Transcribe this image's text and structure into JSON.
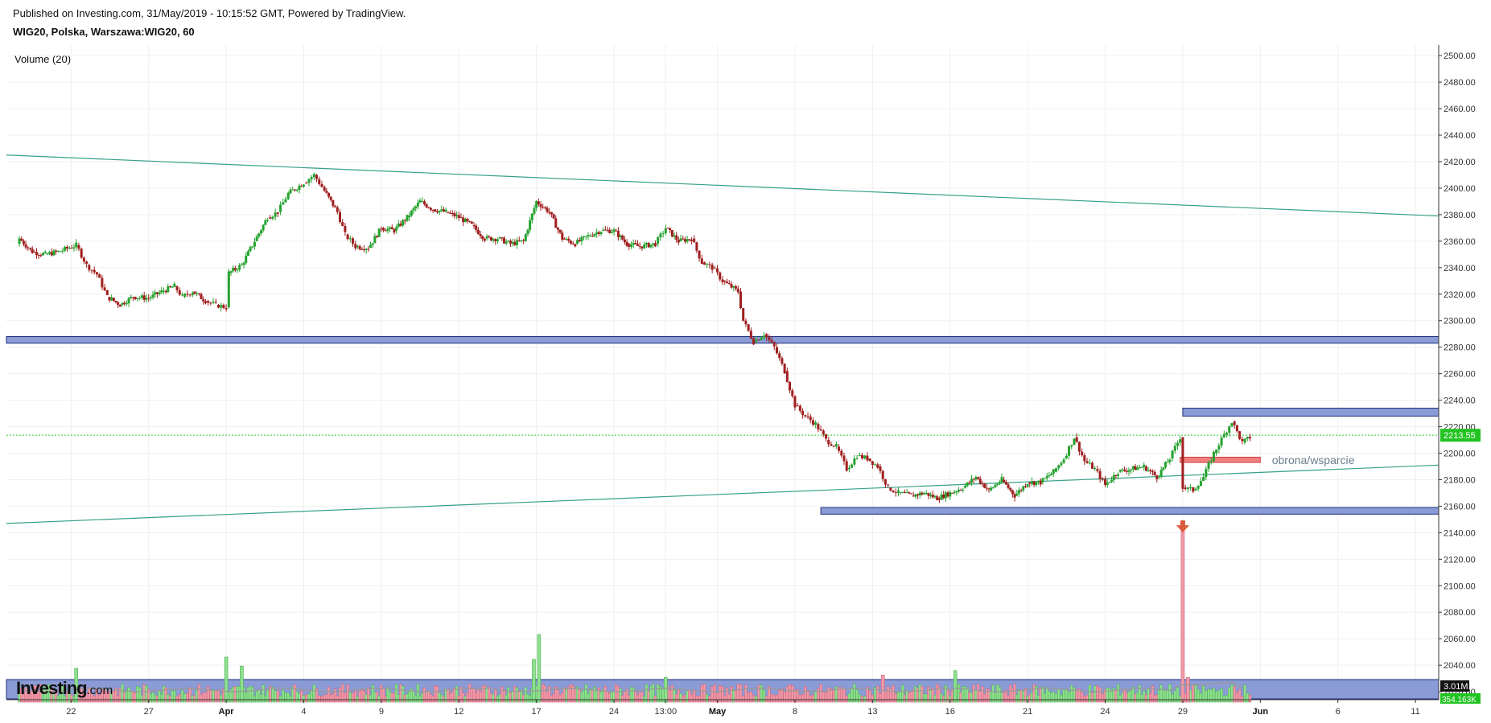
{
  "header": {
    "published": "Published on Investing.com, 31/May/2019 - 10:15:52 GMT, Powered by TradingView.",
    "symbol": "WIG20, Polska, Warszawa:WIG20, 60"
  },
  "volume_label": "Volume (20)",
  "logo": {
    "main": "Investing",
    "sub": ".com"
  },
  "colors": {
    "up": "#26a22f",
    "down": "#a01e1e",
    "vol_up": "#8fe08f",
    "vol_down": "#ef9aa8",
    "zone_fill": "#8a9bd6",
    "zone_stroke": "#1f2f78",
    "trend": "#35a08a",
    "price_line": "#2ecc2e",
    "red_zone": "#f08080",
    "arrow": "#d95a3c"
  },
  "chart_data": {
    "type": "candlestick",
    "title": "WIG20, Polska, Warszawa:WIG20, 60",
    "y_ticks": [
      "2500.00",
      "2480.00",
      "2460.00",
      "2440.00",
      "2420.00",
      "2400.00",
      "2380.00",
      "2360.00",
      "2340.00",
      "2320.00",
      "2300.00",
      "2280.00",
      "2260.00",
      "2240.00",
      "2220.00",
      "2200.00",
      "2180.00",
      "2160.00",
      "2140.00",
      "2120.00",
      "2100.00",
      "2080.00",
      "2060.00",
      "2040.00",
      "2020.00"
    ],
    "x_ticks": [
      {
        "t": 2,
        "label": "22"
      },
      {
        "t": 5,
        "label": "27"
      },
      {
        "t": 8,
        "label": "Apr"
      },
      {
        "t": 11,
        "label": "4"
      },
      {
        "t": 14,
        "label": "9"
      },
      {
        "t": 17,
        "label": "12"
      },
      {
        "t": 20,
        "label": "17"
      },
      {
        "t": 23,
        "label": "24"
      },
      {
        "t": 25,
        "label": "13:00"
      },
      {
        "t": 27,
        "label": "May"
      },
      {
        "t": 30,
        "label": "8"
      },
      {
        "t": 33,
        "label": "13"
      },
      {
        "t": 36,
        "label": "16"
      },
      {
        "t": 39,
        "label": "21"
      },
      {
        "t": 42,
        "label": "24"
      },
      {
        "t": 45,
        "label": "29"
      },
      {
        "t": 48,
        "label": "Jun"
      },
      {
        "t": 51,
        "label": "6"
      },
      {
        "t": 54,
        "label": "11"
      }
    ],
    "bold_x_labels": [
      "Apr",
      "May",
      "Jun"
    ],
    "ylim": [
      2014,
      2508
    ],
    "xlim": [
      -0.5,
      54.9
    ],
    "current_price": 2213.55,
    "current_price_label": "2213.55",
    "volume_labels": [
      "3.01M",
      "354.163K"
    ],
    "price_path": [
      [
        0,
        2362
      ],
      [
        0.5,
        2352
      ],
      [
        1,
        2350
      ],
      [
        1.5,
        2352
      ],
      [
        2.2,
        2357
      ],
      [
        2.6,
        2342
      ],
      [
        3,
        2335
      ],
      [
        3.4,
        2318
      ],
      [
        3.9,
        2312
      ],
      [
        4.4,
        2318
      ],
      [
        5,
        2317
      ],
      [
        5.5,
        2322
      ],
      [
        6,
        2326
      ],
      [
        6.3,
        2318
      ],
      [
        6.7,
        2322
      ],
      [
        7.2,
        2315
      ],
      [
        7.6,
        2312
      ],
      [
        8,
        2310
      ],
      [
        8.1,
        2336
      ],
      [
        8.6,
        2342
      ],
      [
        9.1,
        2360
      ],
      [
        9.6,
        2378
      ],
      [
        10,
        2382
      ],
      [
        10.4,
        2396
      ],
      [
        11,
        2404
      ],
      [
        11.4,
        2410
      ],
      [
        11.8,
        2398
      ],
      [
        12.3,
        2382
      ],
      [
        12.6,
        2365
      ],
      [
        13,
        2356
      ],
      [
        13.5,
        2355
      ],
      [
        14,
        2370
      ],
      [
        14.5,
        2368
      ],
      [
        15,
        2378
      ],
      [
        15.5,
        2390
      ],
      [
        16,
        2384
      ],
      [
        16.5,
        2382
      ],
      [
        17,
        2378
      ],
      [
        17.5,
        2372
      ],
      [
        18,
        2362
      ],
      [
        18.5,
        2362
      ],
      [
        19,
        2358
      ],
      [
        19.5,
        2360
      ],
      [
        20,
        2390
      ],
      [
        20.5,
        2382
      ],
      [
        21,
        2362
      ],
      [
        21.5,
        2358
      ],
      [
        22,
        2364
      ],
      [
        22.5,
        2368
      ],
      [
        23,
        2368
      ],
      [
        23.5,
        2358
      ],
      [
        24,
        2356
      ],
      [
        24.6,
        2358
      ],
      [
        25,
        2370
      ],
      [
        25.5,
        2360
      ],
      [
        26,
        2362
      ],
      [
        26.4,
        2344
      ],
      [
        26.8,
        2340
      ],
      [
        27.2,
        2330
      ],
      [
        27.8,
        2322
      ],
      [
        28,
        2300
      ],
      [
        28.4,
        2284
      ],
      [
        28.8,
        2290
      ],
      [
        29.2,
        2280
      ],
      [
        29.6,
        2262
      ],
      [
        30,
        2236
      ],
      [
        30.4,
        2228
      ],
      [
        30.8,
        2222
      ],
      [
        31.2,
        2210
      ],
      [
        31.6,
        2205
      ],
      [
        32,
        2188
      ],
      [
        32.4,
        2198
      ],
      [
        32.8,
        2196
      ],
      [
        33.2,
        2190
      ],
      [
        33.6,
        2174
      ],
      [
        34,
        2170
      ],
      [
        34.5,
        2168
      ],
      [
        35,
        2170
      ],
      [
        35.5,
        2166
      ],
      [
        36,
        2170
      ],
      [
        36.5,
        2174
      ],
      [
        37,
        2182
      ],
      [
        37.5,
        2172
      ],
      [
        38,
        2180
      ],
      [
        38.5,
        2168
      ],
      [
        39,
        2178
      ],
      [
        39.5,
        2178
      ],
      [
        40,
        2186
      ],
      [
        40.4,
        2196
      ],
      [
        40.8,
        2212
      ],
      [
        41.2,
        2194
      ],
      [
        41.6,
        2188
      ],
      [
        42,
        2176
      ],
      [
        42.5,
        2186
      ],
      [
        43,
        2188
      ],
      [
        43.5,
        2190
      ],
      [
        44,
        2182
      ],
      [
        44.5,
        2196
      ],
      [
        44.9,
        2212
      ],
      [
        45,
        2174
      ],
      [
        45.4,
        2172
      ],
      [
        45.8,
        2182
      ],
      [
        46.2,
        2200
      ],
      [
        46.6,
        2214
      ],
      [
        46.9,
        2224
      ],
      [
        47.3,
        2208
      ],
      [
        47.6,
        2212
      ]
    ],
    "volume_spikes": [
      {
        "t": 2.2,
        "v": 1.5,
        "dir": "up"
      },
      {
        "t": 8.0,
        "v": 2.0,
        "dir": "up"
      },
      {
        "t": 8.6,
        "v": 1.6,
        "dir": "up"
      },
      {
        "t": 19.9,
        "v": 1.9,
        "dir": "up"
      },
      {
        "t": 20.1,
        "v": 3.0,
        "dir": "up"
      },
      {
        "t": 25.0,
        "v": 1.1,
        "dir": "up"
      },
      {
        "t": 33.4,
        "v": 1.2,
        "dir": "down"
      },
      {
        "t": 36.2,
        "v": 1.4,
        "dir": "up"
      },
      {
        "t": 45.0,
        "v": 8.0,
        "dir": "down"
      },
      {
        "t": 45.2,
        "v": 1.1,
        "dir": "down"
      }
    ],
    "support_zones": [
      {
        "t1": -0.5,
        "t2": 54.9,
        "lo": 2283,
        "hi": 2288
      },
      {
        "t1": 31.0,
        "t2": 54.9,
        "lo": 2154,
        "hi": 2159
      },
      {
        "t1": 45.0,
        "t2": 54.9,
        "lo": 2228,
        "hi": 2234
      }
    ],
    "red_zone": {
      "t1": 44.9,
      "t2": 48.0,
      "lo": 2193,
      "hi": 2197
    },
    "trendlines": [
      {
        "t1": -0.5,
        "p1": 2425,
        "t2": 54.9,
        "p2": 2379
      },
      {
        "t1": -0.5,
        "p1": 2147,
        "t2": 54.9,
        "p2": 2191
      }
    ],
    "annotation": {
      "text": "obrona/wsparcie",
      "t": 48.2,
      "p": 2195
    },
    "arrow": {
      "t": 45.0,
      "p": 2142
    }
  }
}
